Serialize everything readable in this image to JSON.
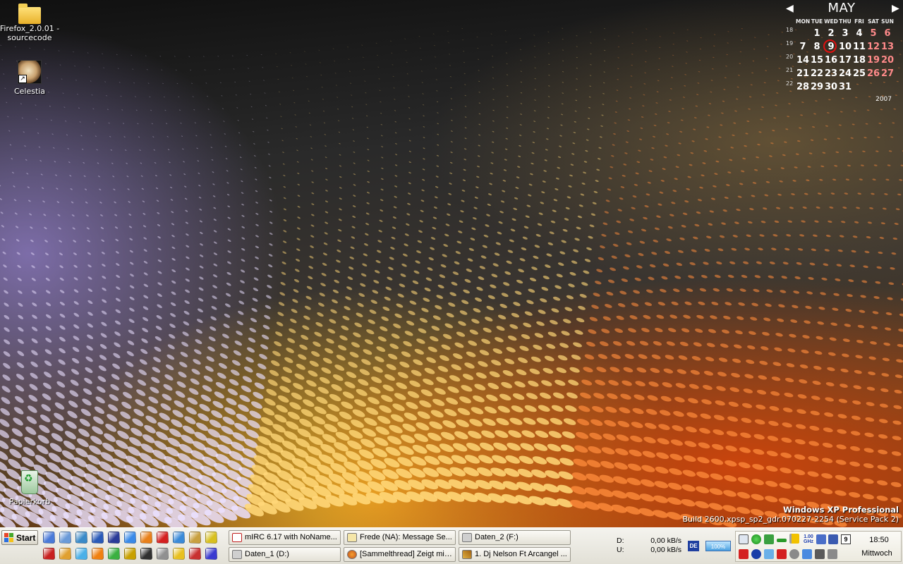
{
  "desktop": {
    "icons": [
      {
        "label": "Firefox_2.0.01 - sourcecode",
        "icon": "folder-icon"
      },
      {
        "label": "Celestia",
        "icon": "planet-shortcut-icon"
      },
      {
        "label": "Papierkorb",
        "icon": "recycle-bin-icon"
      }
    ]
  },
  "calendar": {
    "month": "MAY",
    "year": "2007",
    "weekday_headers": [
      "MON",
      "TUE",
      "WED",
      "THU",
      "FRI",
      "SAT",
      "SUN"
    ],
    "weeks": [
      {
        "number": "18",
        "days": [
          "",
          "1",
          "2",
          "3",
          "4",
          "5",
          "6"
        ]
      },
      {
        "number": "19",
        "days": [
          "7",
          "8",
          "9",
          "10",
          "11",
          "12",
          "13"
        ]
      },
      {
        "number": "20",
        "days": [
          "14",
          "15",
          "16",
          "17",
          "18",
          "19",
          "20"
        ]
      },
      {
        "number": "21",
        "days": [
          "21",
          "22",
          "23",
          "24",
          "25",
          "26",
          "27"
        ]
      },
      {
        "number": "22",
        "days": [
          "28",
          "29",
          "30",
          "31",
          "",
          "",
          ""
        ]
      }
    ],
    "today": "9",
    "weekend_color": "#ff8a8a",
    "today_ring_color": "#e01010"
  },
  "watermark": {
    "title": "Windows XP Professional",
    "build": "Build 2600.xpsp_sp2_gdr.070227-2254 (Service Pack 2)"
  },
  "taskbar": {
    "start_label": "Start",
    "quick_launch": [
      "show-desktop-icon",
      "cpu-tool-icon",
      "network-icon",
      "fc-icon",
      "save-disk-icon",
      "internet-explorer-icon",
      "firefox-icon",
      "opera-icon",
      "thunderbird-icon",
      "glasses-icon",
      "pawn-icon",
      "pdf-icon",
      "pencil-tool-icon",
      "itunes-icon",
      "vlc-icon",
      "utorrent-icon",
      "brush-icon",
      "w-app-icon",
      "keyboard-icon",
      "pacman-icon",
      "globe-red-icon",
      "media-player-icon"
    ],
    "tasks": [
      {
        "label": "mIRC 6.17 with NoName...",
        "icon": "mirc-icon"
      },
      {
        "label": "Frede (NA): Message Se...",
        "icon": "message-icon"
      },
      {
        "label": "Daten_2 (F:)",
        "icon": "drive-icon"
      },
      {
        "label": "Daten_1 (D:)",
        "icon": "drive-icon"
      },
      {
        "label": "[Sammelthread] Zeigt mir...",
        "icon": "firefox-icon"
      },
      {
        "label": "1. Dj Nelson Ft Arcangel ...",
        "icon": "audio-player-icon"
      }
    ],
    "net_meter": {
      "down_label": "D:",
      "down_value": "0,00 kB/s",
      "up_label": "U:",
      "up_value": "0,00 kB/s"
    },
    "language": "DE",
    "battery_percent": "100%",
    "tray": {
      "cpu_freq": "1.00 GHz",
      "calendar_day": "9",
      "time": "18:50",
      "day": "Mittwoch"
    }
  }
}
